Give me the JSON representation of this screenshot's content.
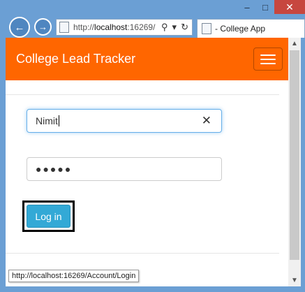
{
  "browser": {
    "window_controls": {
      "minimize": "–",
      "maximize": "□",
      "close": "✕"
    },
    "address": {
      "prefix": "http://",
      "host": "localhost",
      "rest": ":16269/"
    },
    "tab_title": "- College App",
    "status_url": "http://localhost:16269/Account/Login"
  },
  "app": {
    "brand": "College Lead Tracker",
    "login": {
      "username_value": "Nimit",
      "password_mask": "●●●●●",
      "clear_glyph": "✕",
      "login_label": "Log in"
    }
  },
  "colors": {
    "navbar": "#ff6600",
    "button": "#33a9d6",
    "focus_ring": "#66afe9"
  }
}
